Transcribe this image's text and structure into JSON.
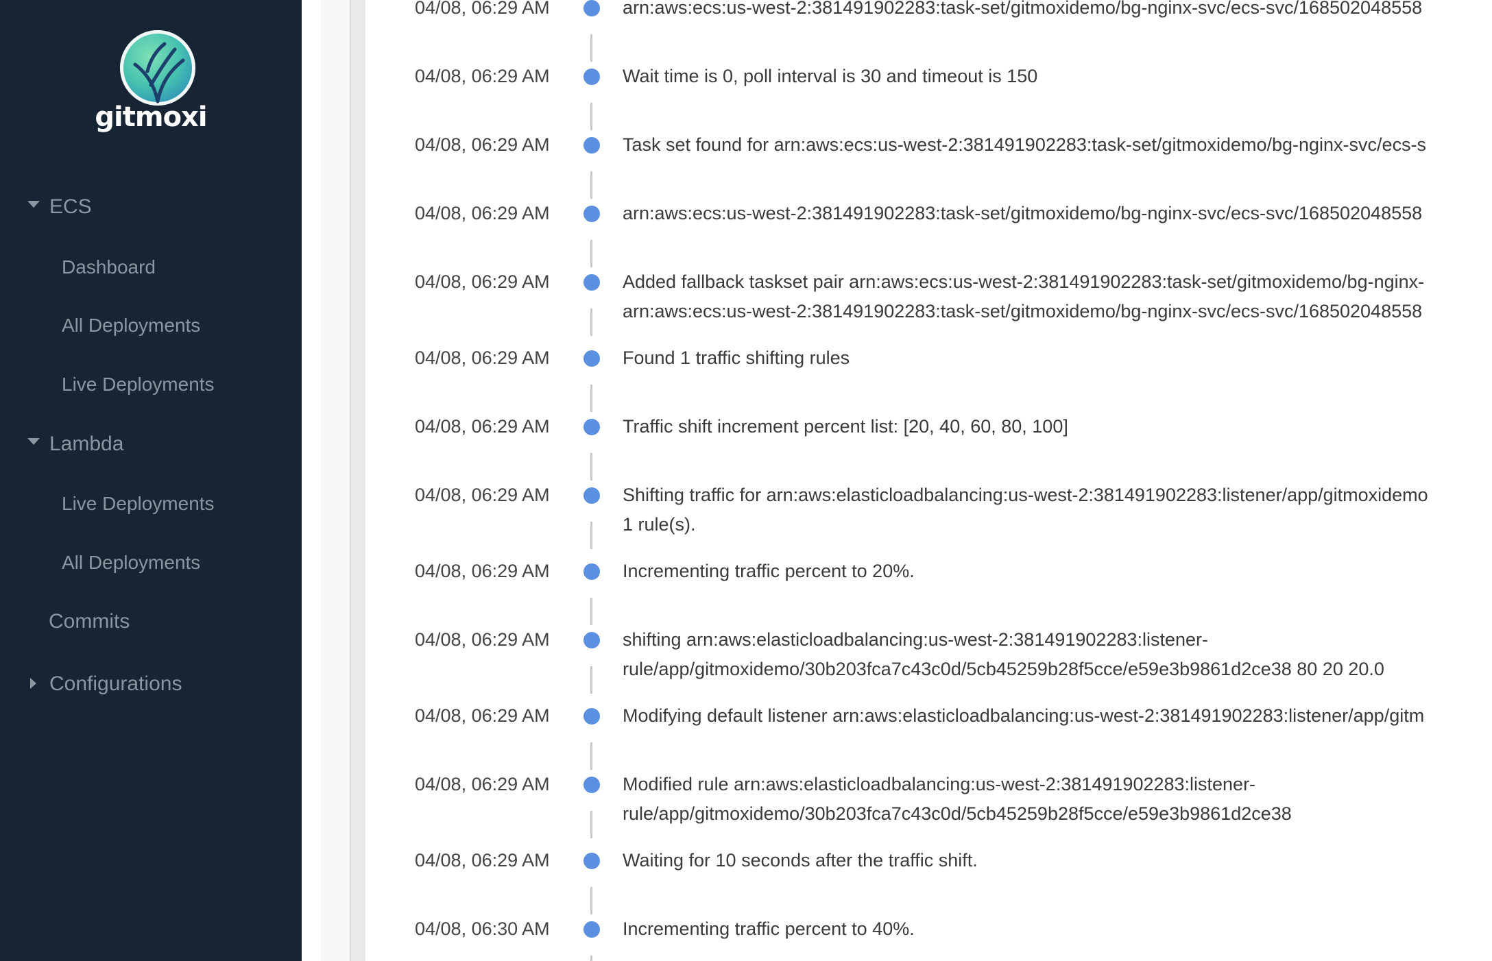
{
  "brand": {
    "name": "gitmoxi"
  },
  "sidebar": {
    "ecs": {
      "label": "ECS",
      "items": [
        "Dashboard",
        "All Deployments",
        "Live Deployments"
      ]
    },
    "lambda": {
      "label": "Lambda",
      "items": [
        "Live Deployments",
        "All Deployments"
      ]
    },
    "commits": "Commits",
    "configurations": "Configurations"
  },
  "colors": {
    "sidebar_bg": "#172433",
    "dot": "#5b8fe0"
  },
  "timeline": [
    {
      "time": "04/08, 06:29 AM",
      "lines": [
        "arn:aws:ecs:us-west-2:381491902283:task-set/gitmoxidemo/bg-nginx-svc/ecs-svc/168502048558"
      ]
    },
    {
      "time": "04/08, 06:29 AM",
      "lines": [
        "Wait time is 0, poll interval is 30 and timeout is 150"
      ]
    },
    {
      "time": "04/08, 06:29 AM",
      "lines": [
        "Task set found for arn:aws:ecs:us-west-2:381491902283:task-set/gitmoxidemo/bg-nginx-svc/ecs-s"
      ]
    },
    {
      "time": "04/08, 06:29 AM",
      "lines": [
        "arn:aws:ecs:us-west-2:381491902283:task-set/gitmoxidemo/bg-nginx-svc/ecs-svc/168502048558"
      ]
    },
    {
      "time": "04/08, 06:29 AM",
      "lines": [
        "Added fallback taskset pair arn:aws:ecs:us-west-2:381491902283:task-set/gitmoxidemo/bg-nginx-",
        "arn:aws:ecs:us-west-2:381491902283:task-set/gitmoxidemo/bg-nginx-svc/ecs-svc/168502048558"
      ]
    },
    {
      "time": "04/08, 06:29 AM",
      "lines": [
        "Found 1 traffic shifting rules"
      ]
    },
    {
      "time": "04/08, 06:29 AM",
      "lines": [
        "Traffic shift increment percent list: [20, 40, 60, 80, 100]"
      ]
    },
    {
      "time": "04/08, 06:29 AM",
      "lines": [
        "Shifting traffic for arn:aws:elasticloadbalancing:us-west-2:381491902283:listener/app/gitmoxidemo",
        "1 rule(s)."
      ]
    },
    {
      "time": "04/08, 06:29 AM",
      "lines": [
        "Incrementing traffic percent to 20%."
      ]
    },
    {
      "time": "04/08, 06:29 AM",
      "lines": [
        "shifting arn:aws:elasticloadbalancing:us-west-2:381491902283:listener-",
        "rule/app/gitmoxidemo/30b203fca7c43c0d/5cb45259b28f5cce/e59e3b9861d2ce38 80 20 20.0"
      ]
    },
    {
      "time": "04/08, 06:29 AM",
      "lines": [
        "Modifying default listener arn:aws:elasticloadbalancing:us-west-2:381491902283:listener/app/gitm"
      ]
    },
    {
      "time": "04/08, 06:29 AM",
      "lines": [
        "Modified rule arn:aws:elasticloadbalancing:us-west-2:381491902283:listener-",
        "rule/app/gitmoxidemo/30b203fca7c43c0d/5cb45259b28f5cce/e59e3b9861d2ce38"
      ]
    },
    {
      "time": "04/08, 06:29 AM",
      "lines": [
        "Waiting for 10 seconds after the traffic shift."
      ]
    },
    {
      "time": "04/08, 06:30 AM",
      "lines": [
        "Incrementing traffic percent to 40%."
      ]
    }
  ]
}
